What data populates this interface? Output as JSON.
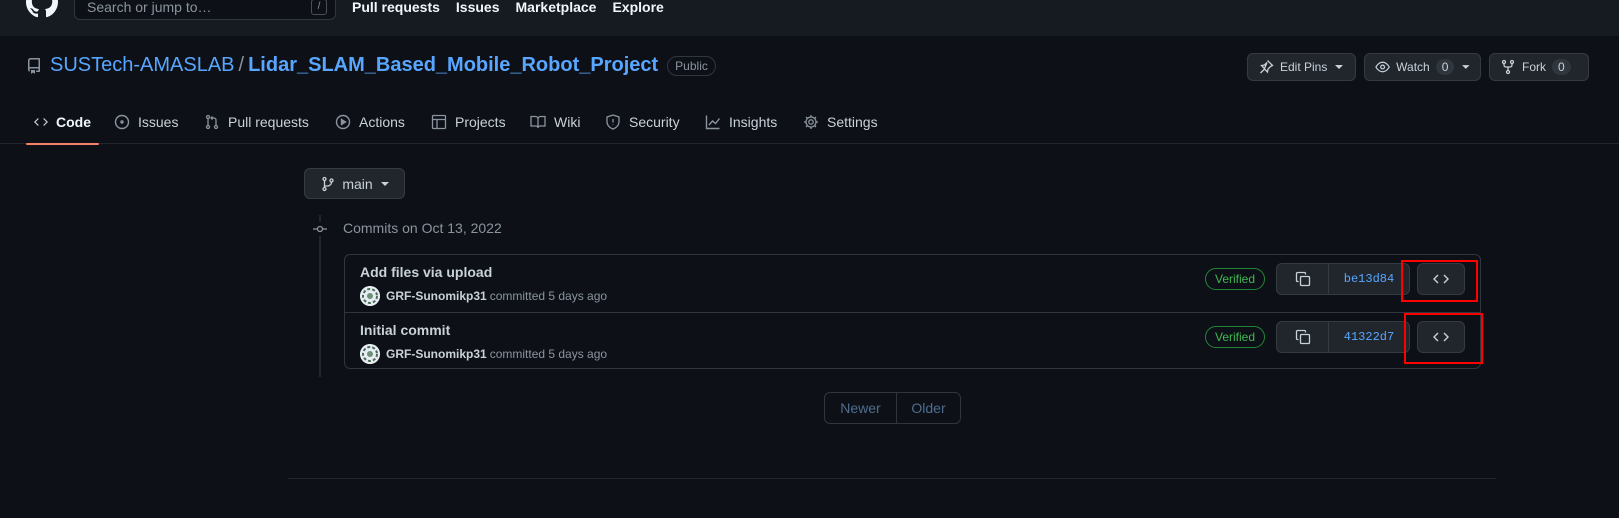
{
  "header": {
    "search_placeholder": "Search or jump to…",
    "search_shortcut": "/",
    "nav": [
      "Pull requests",
      "Issues",
      "Marketplace",
      "Explore"
    ]
  },
  "repo": {
    "owner": "SUSTech-AMASLAB",
    "separator": "/",
    "name": "Lidar_SLAM_Based_Mobile_Robot_Project",
    "visibility": "Public",
    "actions": {
      "edit_pins": "Edit Pins",
      "watch": "Watch",
      "watch_count": "0",
      "fork": "Fork",
      "fork_count": "0"
    }
  },
  "tabs": [
    {
      "label": "Code",
      "icon": "code-icon",
      "active": true
    },
    {
      "label": "Issues",
      "icon": "issue-opened-icon"
    },
    {
      "label": "Pull requests",
      "icon": "git-pull-request-icon"
    },
    {
      "label": "Actions",
      "icon": "play-icon"
    },
    {
      "label": "Projects",
      "icon": "table-icon"
    },
    {
      "label": "Wiki",
      "icon": "book-icon"
    },
    {
      "label": "Security",
      "icon": "shield-icon"
    },
    {
      "label": "Insights",
      "icon": "graph-icon"
    },
    {
      "label": "Settings",
      "icon": "gear-icon"
    }
  ],
  "branch": {
    "name": "main",
    "icon": "git-branch-icon"
  },
  "commits_group": {
    "date_label": "Commits on Oct 13, 2022",
    "commits": [
      {
        "message": "Add files via upload",
        "author": "GRF-Sunomikp31",
        "action_time": "committed 5 days ago",
        "badge": "Verified",
        "sha": "be13d84"
      },
      {
        "message": "Initial commit",
        "author": "GRF-Sunomikp31",
        "action_time": "committed 5 days ago",
        "badge": "Verified",
        "sha": "41322d7"
      }
    ]
  },
  "pagination": {
    "newer": "Newer",
    "older": "Older"
  },
  "colors": {
    "background": "#0d1117",
    "link": "#58a6ff",
    "verified": "#3fb950",
    "active_tab_underline": "#f78166",
    "annotation_box": "#ff0000"
  }
}
